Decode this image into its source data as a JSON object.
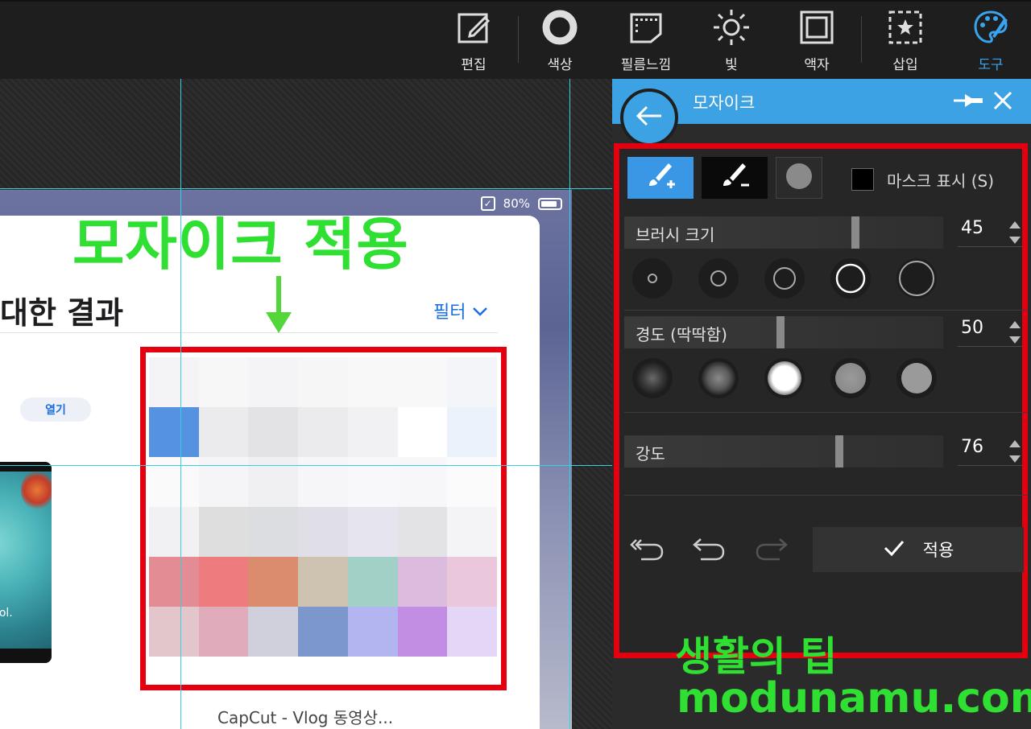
{
  "toolbar": {
    "items": [
      {
        "label": "편집",
        "icon": "edit-icon"
      },
      {
        "label": "색상",
        "icon": "color-ring-icon"
      },
      {
        "label": "필름느낌",
        "icon": "film-icon"
      },
      {
        "label": "빛",
        "icon": "sun-icon"
      },
      {
        "label": "액자",
        "icon": "frame-icon"
      },
      {
        "label": "삽입",
        "icon": "insert-star-icon"
      },
      {
        "label": "도구",
        "icon": "palette-tools-icon"
      }
    ],
    "active": "도구",
    "accent_color": "#3aa3ef"
  },
  "canvas": {
    "annotation_title": "모자이크 적용",
    "annotation_color": "#2fe033",
    "box_color": "#e4000f",
    "screenshot": {
      "battery": "80%",
      "results_title": "대한 결과",
      "filter_label": "필터",
      "open_label": "열기",
      "thumb_caption": "g fool.",
      "app_name": "CapCut - Vlog 동영상..."
    },
    "mosaic_colors": [
      [
        "#f4f4f6",
        "#f7f7f8",
        "#f4f4f6",
        "#f6f6f7",
        "#f8f8f9",
        "#f8f8f9",
        "#f3f5f9"
      ],
      [
        "#5592df",
        "#ebebee",
        "#e3e3e6",
        "#ebebee",
        "#f1f1f3",
        "#ffffff",
        "#ecf2fb"
      ],
      [
        "#fafafb",
        "#f5f5f7",
        "#f0f0f2",
        "#f6f6f8",
        "#f8f8fa",
        "#f7f7f9",
        "#fbfbfc"
      ],
      [
        "#f1f1f3",
        "#dededf",
        "#dcdde0",
        "#e0dfe8",
        "#e6e5ef",
        "#e3e3e6",
        "#f4f4f6"
      ],
      [
        "#e38c94",
        "#ee7b7e",
        "#dc8c6e",
        "#cec2b0",
        "#a1d0c7",
        "#dcbcde",
        "#ebc7db"
      ],
      [
        "#e3c5cc",
        "#e0abba",
        "#d0d0dc",
        "#7c97cc",
        "#b3b5f0",
        "#c28ee4",
        "#e4d6f6"
      ],
      [
        "#ddeeee",
        "#b8c9f9",
        "#b4d6fb",
        "#bcbae6",
        "#d6c9ee",
        "#dbcbe8",
        "#f1e6fb"
      ]
    ]
  },
  "panel": {
    "title": "모자이크",
    "header_color": "#3da2e3",
    "mask_label": "마스크 표시 (S)",
    "brush_size": {
      "label": "브러시 크기",
      "value": "45",
      "fraction": 0.73
    },
    "hardness": {
      "label": "경도 (딱딱함)",
      "value": "50",
      "fraction": 0.49
    },
    "strength": {
      "label": "강도",
      "value": "76",
      "fraction": 0.68
    },
    "apply_label": "적용",
    "selected_size_preset": 4,
    "selected_hardness_preset": 3
  },
  "watermark": {
    "line1": "생활의 팁",
    "line2": "modunamu.com"
  }
}
